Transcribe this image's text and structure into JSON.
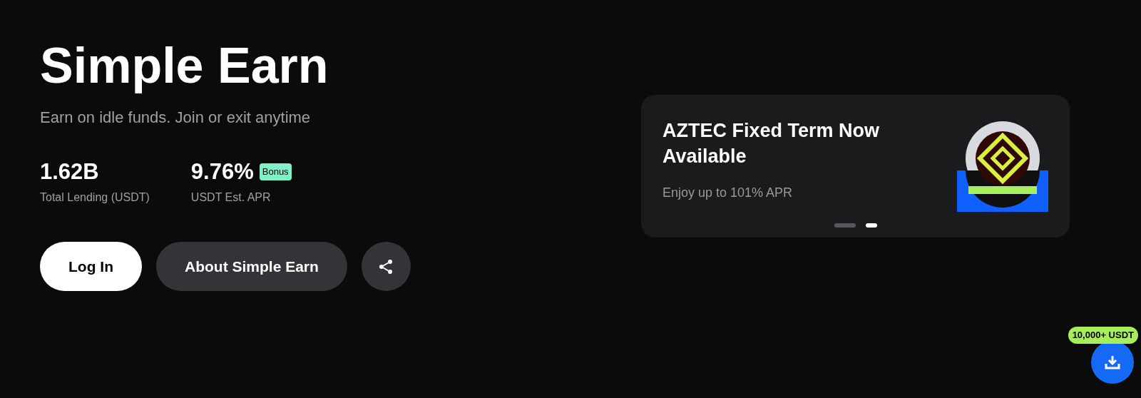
{
  "hero": {
    "title": "Simple Earn",
    "subtitle": "Earn on idle funds. Join or exit anytime"
  },
  "stats": [
    {
      "value": "1.62B",
      "label": "Total Lending (USDT)"
    },
    {
      "value": "9.76%",
      "label": "USDT Est. APR",
      "badge": "Bonus"
    }
  ],
  "buttons": [
    {
      "kind": "primary",
      "label": "Log In"
    },
    {
      "kind": "secondary",
      "label": "About Simple Earn"
    },
    {
      "kind": "share"
    }
  ],
  "promo": {
    "title": "AZTEC Fixed Term Now Available",
    "subtitle": "Enjoy up to 101% APR",
    "dots": [
      {
        "selected": false
      },
      {
        "selected": true
      }
    ]
  },
  "download": {
    "badge": "10,000+ USDT"
  }
}
